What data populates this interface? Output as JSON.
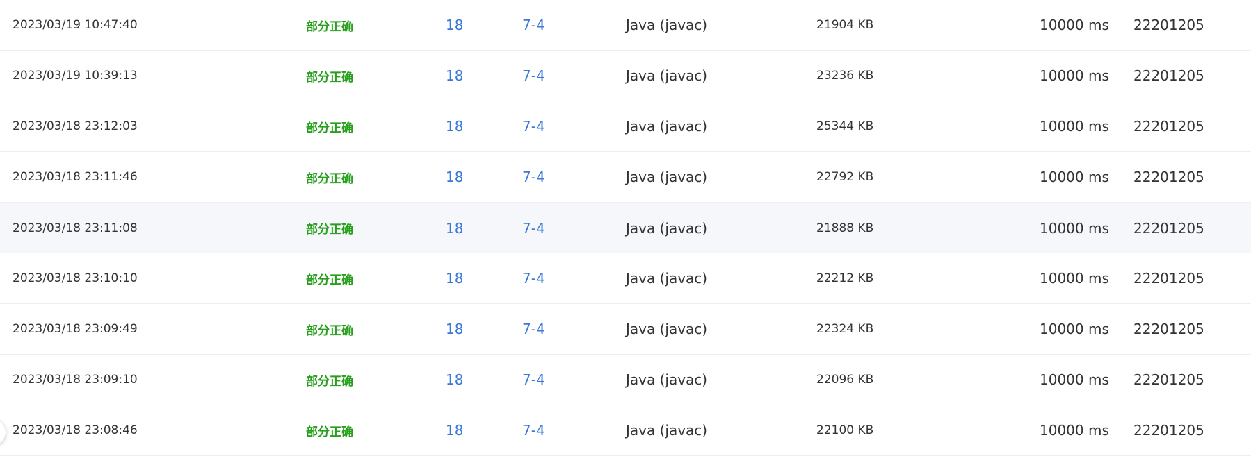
{
  "colors": {
    "status_partial": "#28a01e",
    "link": "#3a78d8",
    "text": "#333333",
    "row_hover": "#f5f7fa",
    "row_border": "#ebeef5"
  },
  "submissions": [
    {
      "submitted_at": "2023/03/19 10:47:40",
      "status": "部分正确",
      "score": "18",
      "problem": "7-4",
      "compiler": "Java (javac)",
      "memory": "21904 KB",
      "time": "10000 ms",
      "user": "22201205"
    },
    {
      "submitted_at": "2023/03/19 10:39:13",
      "status": "部分正确",
      "score": "18",
      "problem": "7-4",
      "compiler": "Java (javac)",
      "memory": "23236 KB",
      "time": "10000 ms",
      "user": "22201205"
    },
    {
      "submitted_at": "2023/03/18 23:12:03",
      "status": "部分正确",
      "score": "18",
      "problem": "7-4",
      "compiler": "Java (javac)",
      "memory": "25344 KB",
      "time": "10000 ms",
      "user": "22201205"
    },
    {
      "submitted_at": "2023/03/18 23:11:46",
      "status": "部分正确",
      "score": "18",
      "problem": "7-4",
      "compiler": "Java (javac)",
      "memory": "22792 KB",
      "time": "10000 ms",
      "user": "22201205"
    },
    {
      "submitted_at": "2023/03/18 23:11:08",
      "status": "部分正确",
      "score": "18",
      "problem": "7-4",
      "compiler": "Java (javac)",
      "memory": "21888 KB",
      "time": "10000 ms",
      "user": "22201205"
    },
    {
      "submitted_at": "2023/03/18 23:10:10",
      "status": "部分正确",
      "score": "18",
      "problem": "7-4",
      "compiler": "Java (javac)",
      "memory": "22212 KB",
      "time": "10000 ms",
      "user": "22201205"
    },
    {
      "submitted_at": "2023/03/18 23:09:49",
      "status": "部分正确",
      "score": "18",
      "problem": "7-4",
      "compiler": "Java (javac)",
      "memory": "22324 KB",
      "time": "10000 ms",
      "user": "22201205"
    },
    {
      "submitted_at": "2023/03/18 23:09:10",
      "status": "部分正确",
      "score": "18",
      "problem": "7-4",
      "compiler": "Java (javac)",
      "memory": "22096 KB",
      "time": "10000 ms",
      "user": "22201205"
    },
    {
      "submitted_at": "2023/03/18 23:08:46",
      "status": "部分正确",
      "score": "18",
      "problem": "7-4",
      "compiler": "Java (javac)",
      "memory": "22100 KB",
      "time": "10000 ms",
      "user": "22201205"
    }
  ]
}
